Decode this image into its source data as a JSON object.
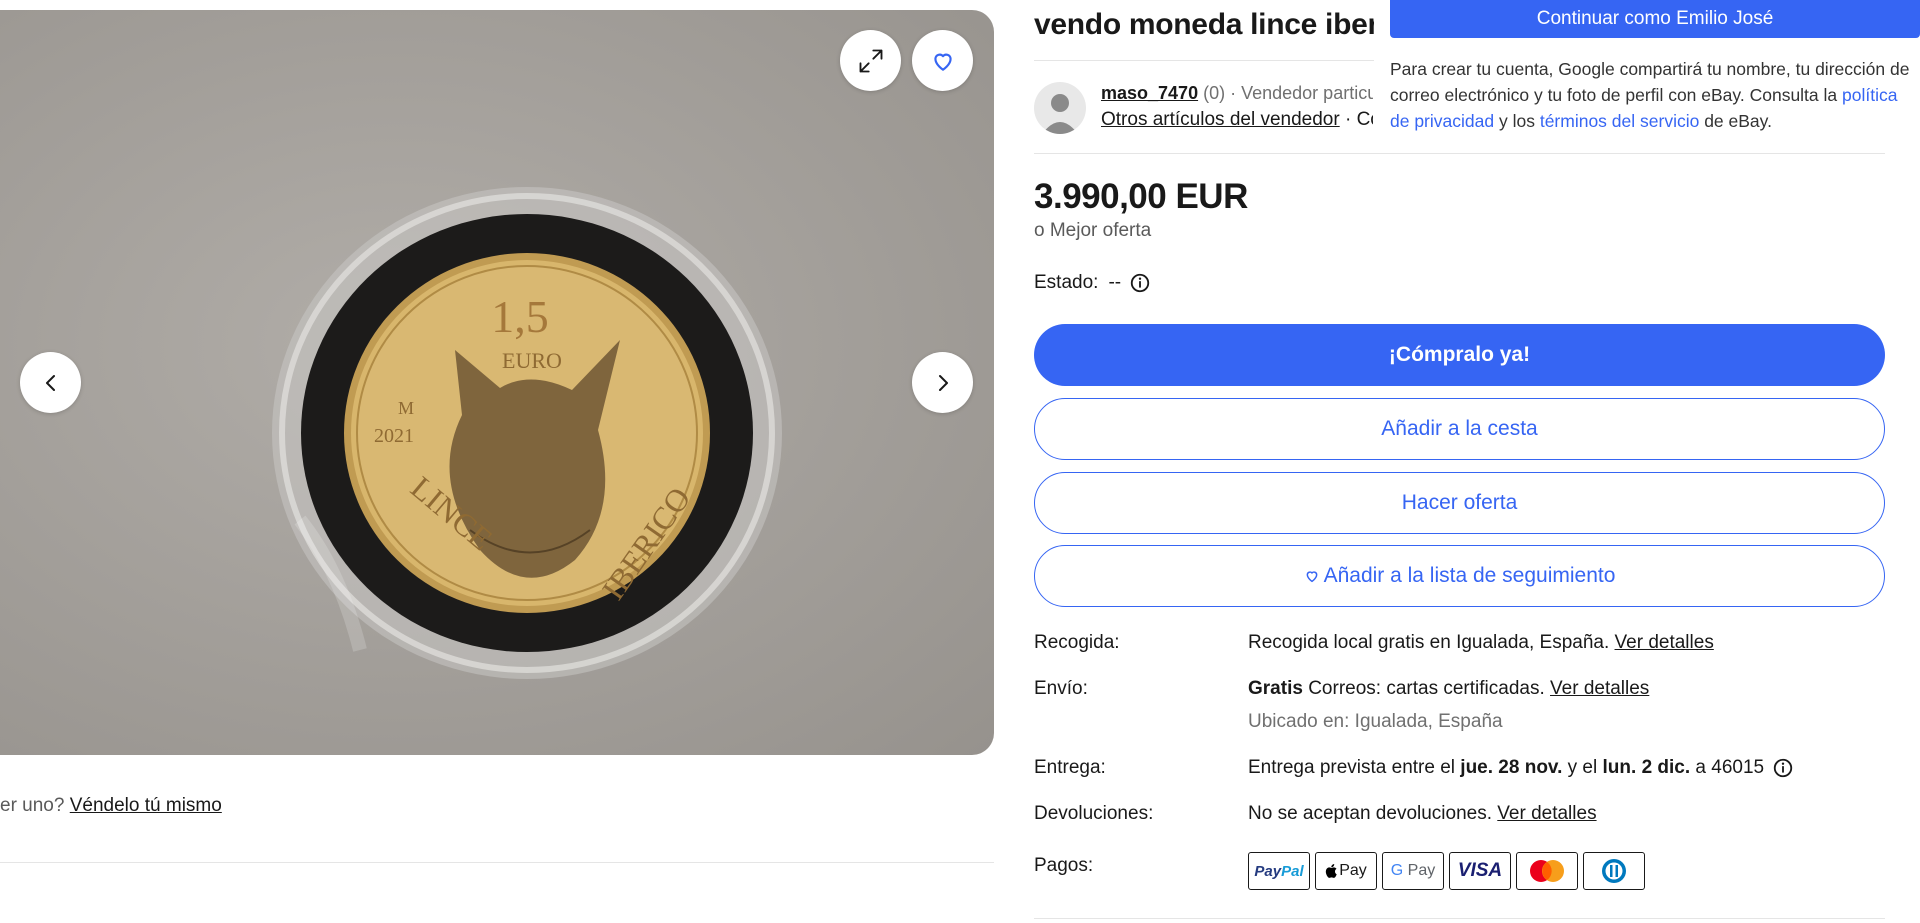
{
  "gallery": {
    "coin": {
      "denomination": "1,5",
      "currency": "EURO",
      "mint_mark": "M",
      "year": "2021",
      "text_left": "LINCE",
      "text_right": "IBERICO"
    },
    "icons": {
      "expand": "expand-icon",
      "favorite": "heart-icon",
      "prev": "chevron-left-icon",
      "next": "chevron-right-icon"
    }
  },
  "sell_prompt": {
    "text": "er uno?",
    "link": "Véndelo tú mismo"
  },
  "listing": {
    "title": "vendo moneda lince iberico"
  },
  "seller": {
    "name": "maso_7470",
    "feedback": "(0)",
    "type": "· Vendedor particular",
    "other_items": "Otros artículos del vendedor",
    "contact": "· Contactar con el vendedor"
  },
  "google_popup": {
    "button": "Continuar como Emilio José",
    "text_1": "Para crear tu cuenta, Google compartirá tu nombre, tu dirección de correo electrónico y tu foto de perfil con eBay. Consulta la ",
    "privacy_link": "política de privacidad",
    "text_2": " y los ",
    "terms_link": "términos del servicio",
    "text_3": " de eBay."
  },
  "price": {
    "amount": "3.990,00 EUR",
    "best_offer": "o Mejor oferta"
  },
  "condition": {
    "label": "Estado:",
    "value": "--"
  },
  "buttons": {
    "buy_now": "¡Cómpralo ya!",
    "add_to_cart": "Añadir a la cesta",
    "make_offer": "Hacer oferta",
    "watchlist": "Añadir a la lista de seguimiento"
  },
  "details": {
    "pickup": {
      "label": "Recogida:",
      "value": "Recogida local gratis en Igualada, España.",
      "link": "Ver detalles"
    },
    "shipping": {
      "label": "Envío:",
      "bold": "Gratis",
      "value": "Correos: cartas certificadas.",
      "link": "Ver detalles",
      "location": "Ubicado en: Igualada, España"
    },
    "delivery": {
      "label": "Entrega:",
      "prefix": "Entrega prevista entre el",
      "date_from": "jue. 28 nov.",
      "middle": "y el",
      "date_to": "lun. 2 dic.",
      "suffix": "a 46015"
    },
    "returns": {
      "label": "Devoluciones:",
      "value": "No se aceptan devoluciones.",
      "link": "Ver detalles"
    },
    "payments": {
      "label": "Pagos:",
      "methods": [
        "PayPal",
        "Apple Pay",
        "G Pay",
        "VISA",
        "Mastercard",
        "Diners Club"
      ]
    }
  },
  "colors": {
    "accent": "#3665f3",
    "text": "#191919",
    "muted": "#707070"
  }
}
